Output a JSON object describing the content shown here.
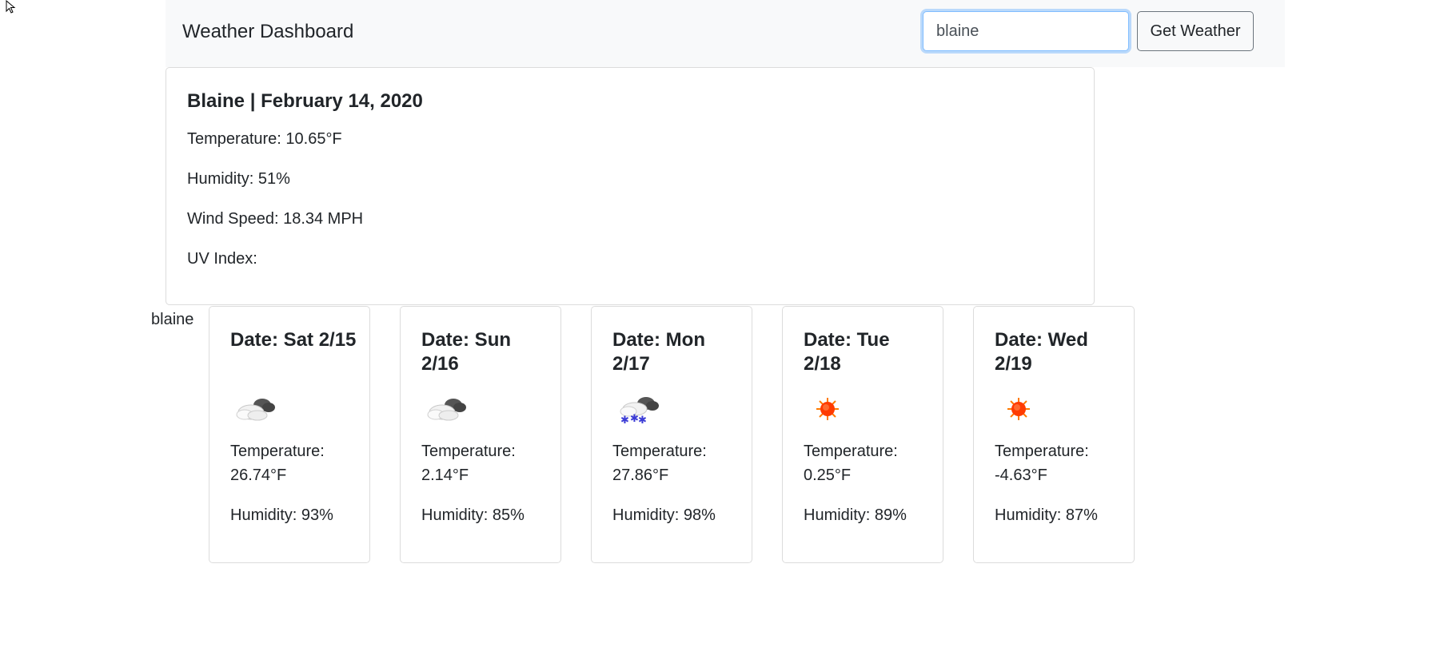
{
  "navbar": {
    "brand": "Weather Dashboard",
    "search_value": "blaine",
    "button_label": "Get Weather"
  },
  "current": {
    "title": "Blaine | February 14, 2020",
    "temperature": "Temperature: 10.65°F",
    "humidity": "Humidity: 51%",
    "wind_speed": "Wind Speed: 18.34 MPH",
    "uv_index": "UV Index:"
  },
  "history": [
    "blaine"
  ],
  "temperature_label": "Temperature:",
  "forecast": [
    {
      "date": "Date: Sat 2/15",
      "icon": "partly-cloudy-icon",
      "temperature": "26.74°F",
      "humidity": "Humidity: 93%"
    },
    {
      "date": "Date: Sun 2/16",
      "icon": "partly-cloudy-icon",
      "temperature": "2.14°F",
      "humidity": "Humidity: 85%"
    },
    {
      "date": "Date: Mon 2/17",
      "icon": "snow-icon",
      "temperature": "27.86°F",
      "humidity": "Humidity: 98%"
    },
    {
      "date": "Date: Tue 2/18",
      "icon": "sun-icon",
      "temperature": "0.25°F",
      "humidity": "Humidity: 89%"
    },
    {
      "date": "Date: Wed 2/19",
      "icon": "sun-icon",
      "temperature": "-4.63°F",
      "humidity": "Humidity: 87%"
    }
  ],
  "colors": {
    "navbar_bg": "#f8f9fa",
    "focus_border": "#80bdff",
    "sun": "#ff3b00",
    "snow": "#3b3bd6"
  }
}
